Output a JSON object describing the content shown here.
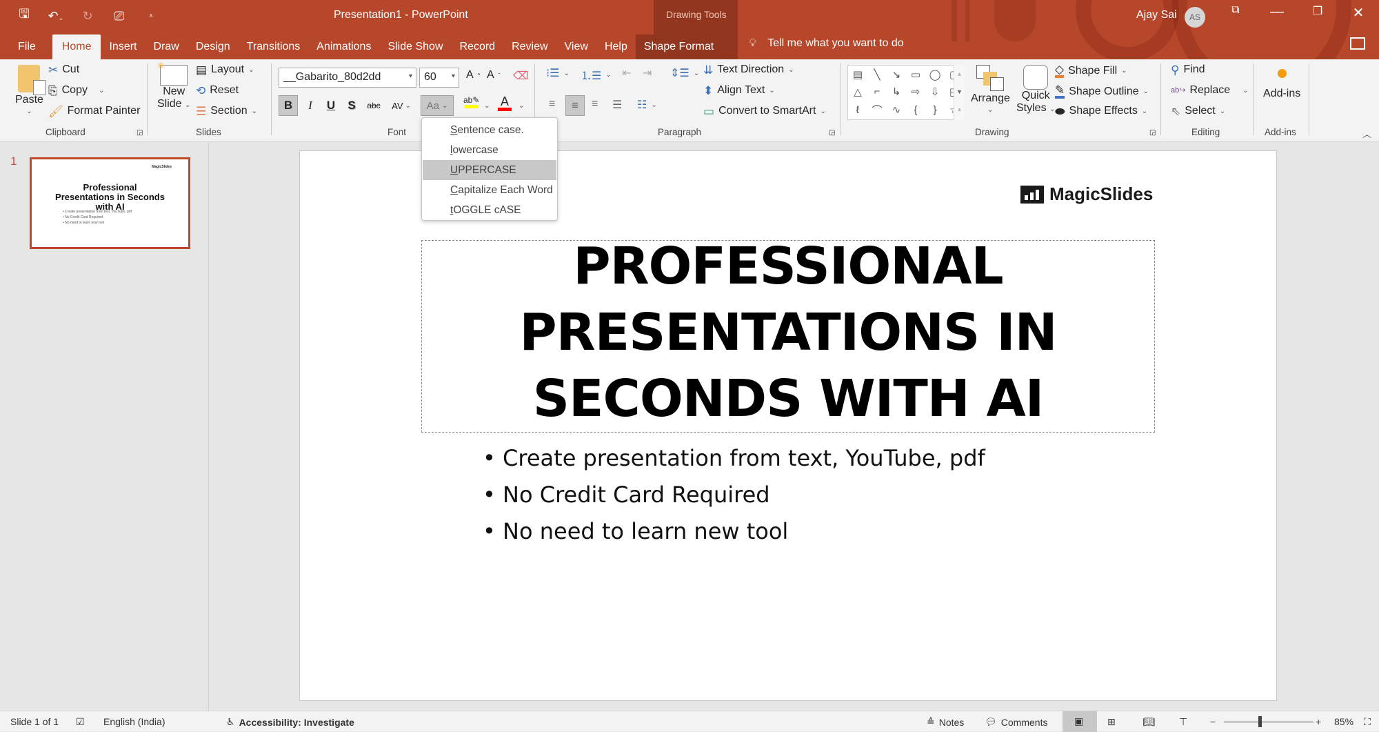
{
  "window": {
    "title": "Presentation1  -  PowerPoint",
    "context_group": "Drawing Tools",
    "user_name": "Ajay Sai",
    "user_initials": "AS"
  },
  "qat": {
    "save_icon": "save-icon",
    "undo_icon": "undo-icon",
    "redo_icon": "redo-icon",
    "present_icon": "start-from-beginning-icon",
    "customize_icon": "customize-qat-icon"
  },
  "tabs": [
    "File",
    "Home",
    "Insert",
    "Draw",
    "Design",
    "Transitions",
    "Animations",
    "Slide Show",
    "Record",
    "Review",
    "View",
    "Help",
    "Shape Format"
  ],
  "active_tab": "Home",
  "tell_me": "Tell me what you want to do",
  "ribbon": {
    "clipboard": {
      "label": "Clipboard",
      "paste": "Paste",
      "cut": "Cut",
      "copy": "Copy",
      "format_painter": "Format Painter"
    },
    "slides": {
      "label": "Slides",
      "new_slide_1": "New",
      "new_slide_2": "Slide",
      "layout": "Layout",
      "reset": "Reset",
      "section": "Section"
    },
    "font": {
      "label": "Font",
      "font_name": "__Gabarito_80d2dd",
      "font_size": "60",
      "bold": "B",
      "italic": "I",
      "underline": "U",
      "shadow": "S",
      "strike": "abc",
      "spacing": "AV",
      "change_case": "Aa",
      "highlight_color": "#ffff00",
      "font_color": "#ff0000"
    },
    "paragraph": {
      "label": "Paragraph",
      "text_direction": "Text Direction",
      "align_text": "Align Text",
      "convert_smartart": "Convert to SmartArt"
    },
    "drawing": {
      "label": "Drawing",
      "arrange": "Arrange",
      "quick_1": "Quick",
      "quick_2": "Styles",
      "shape_fill": "Shape Fill",
      "shape_outline": "Shape Outline",
      "shape_effects": "Shape Effects",
      "shape_fill_color": "#ed7d31",
      "shape_outline_color": "#4472c4"
    },
    "editing": {
      "label": "Editing",
      "find": "Find",
      "replace": "Replace",
      "select": "Select"
    },
    "addins": {
      "label": "Add-ins",
      "button": "Add-ins"
    }
  },
  "change_case_menu": {
    "items": [
      {
        "first": "S",
        "rest": "entence case."
      },
      {
        "first": "l",
        "rest": "owercase"
      },
      {
        "first": "U",
        "rest": "PPERCASE"
      },
      {
        "first": "C",
        "rest": "apitalize Each Word"
      },
      {
        "first": "t",
        "rest": "OGGLE cASE"
      }
    ],
    "highlighted": "UPPERCASE"
  },
  "thumbnails": [
    {
      "number": "1",
      "title": "Professional Presentations in Seconds with AI",
      "logo": "MagicSlides",
      "bullets": [
        "Create presentation from text, YouTube, pdf",
        "No Credit Card Required",
        "No need to learn new tool"
      ]
    }
  ],
  "slide": {
    "logo_text": "MagicSlides",
    "title_lines": [
      "PROFESSIONAL",
      "PRESENTATIONS IN",
      "SECONDS WITH AI"
    ],
    "bullets": [
      "Create presentation from text, YouTube, pdf",
      "No Credit Card Required",
      "No need to learn new tool"
    ]
  },
  "status": {
    "slide_info": "Slide 1 of 1",
    "language": "English (India)",
    "accessibility": "Accessibility: Investigate",
    "notes": "Notes",
    "comments": "Comments",
    "zoom_level": "85%",
    "zoom_percent": 85
  },
  "colors": {
    "accent": "#b7472a",
    "context_tab": "#933620"
  }
}
